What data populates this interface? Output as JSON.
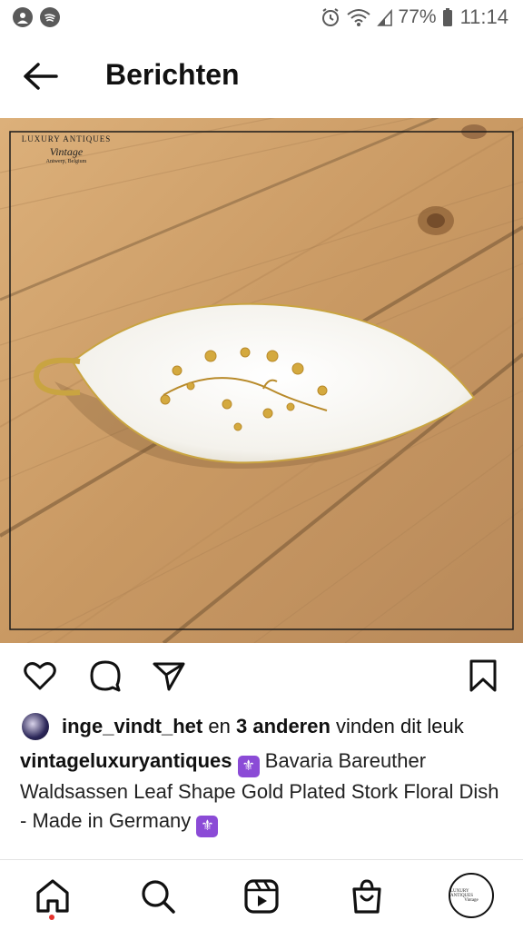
{
  "status_bar": {
    "battery": "77%",
    "time": "11:14",
    "left_icons": [
      "account-circle-icon",
      "spotify-icon"
    ],
    "right_icons": [
      "alarm-icon",
      "wifi-icon",
      "signal-icon",
      "battery-icon"
    ]
  },
  "header": {
    "title": "Berichten",
    "back_icon": "arrow-left-icon"
  },
  "post": {
    "image_watermark": {
      "brand": "LUXURY ANTIQUES",
      "tagline": "Vintage",
      "location": "Antwerp, Belgium"
    },
    "actions": [
      "heart-icon",
      "comment-icon",
      "share-icon",
      "bookmark-icon"
    ],
    "likes": {
      "user": "inge_vindt_het",
      "connector": "en",
      "others": "3 anderen",
      "suffix": "vinden dit leuk"
    },
    "caption": {
      "author": "vintageluxuryantiques",
      "emoji": "⚜",
      "text": "Bavaria Bareuther Waldsassen Leaf Shape Gold Plated Stork Floral Dish - Made in Germany"
    }
  },
  "bottom_nav": {
    "items": [
      "home-icon",
      "search-icon",
      "reels-icon",
      "shop-icon",
      "profile-avatar"
    ],
    "profile_badge": {
      "brand": "LUXURY ANTIQUES",
      "tagline": "Vintage"
    }
  },
  "colors": {
    "text": "#111111",
    "secondary": "#5a5a5a",
    "notification_dot": "#e5322d",
    "emoji_bg": "#8b4bd6",
    "wood": "#c7935c"
  }
}
